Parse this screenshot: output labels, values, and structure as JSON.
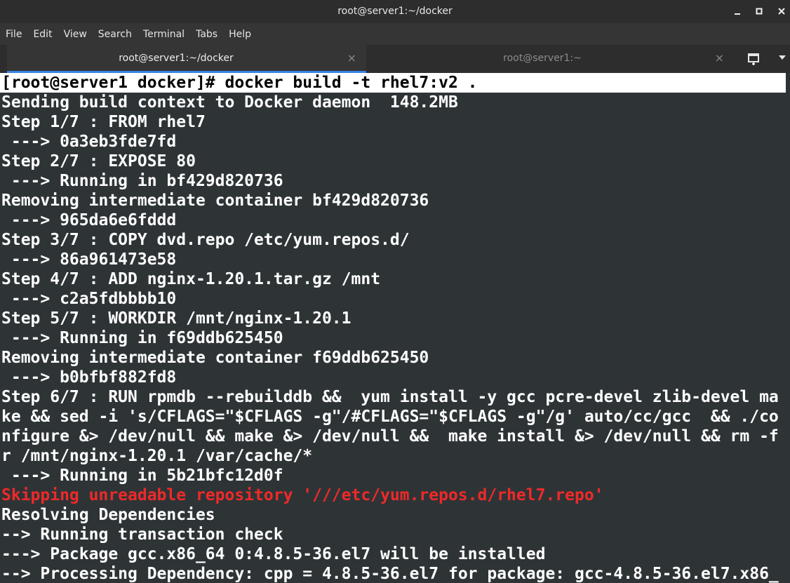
{
  "window": {
    "title": "root@server1:~/docker",
    "minimize_icon": "minimize-icon",
    "maximize_icon": "maximize-icon",
    "close_icon": "close-icon"
  },
  "menubar": {
    "items": [
      "File",
      "Edit",
      "View",
      "Search",
      "Terminal",
      "Tabs",
      "Help"
    ]
  },
  "tabs": [
    {
      "label": "root@server1:~/docker",
      "active": true,
      "close": "×"
    },
    {
      "label": "root@server1:~",
      "active": false,
      "close": "×"
    }
  ],
  "tab_actions": {
    "new_tab_icon": "new-tab-icon",
    "tab_menu_icon": "chevron-down-icon"
  },
  "colors": {
    "terminal_bg": "#2e3436",
    "text": "#ffffff",
    "error": "#ef2929",
    "accent": "#3584e4"
  },
  "terminal": {
    "lines": [
      "[root@server1 docker]# docker build -t rhel7:v2 .",
      "Sending build context to Docker daemon  148.2MB",
      "Step 1/7 : FROM rhel7",
      " ---> 0a3eb3fde7fd",
      "Step 2/7 : EXPOSE 80",
      " ---> Running in bf429d820736",
      "Removing intermediate container bf429d820736",
      " ---> 965da6e6fddd",
      "Step 3/7 : COPY dvd.repo /etc/yum.repos.d/",
      " ---> 86a961473e58",
      "Step 4/7 : ADD nginx-1.20.1.tar.gz /mnt",
      " ---> c2a5fdbbbb10",
      "Step 5/7 : WORKDIR /mnt/nginx-1.20.1",
      " ---> Running in f69ddb625450",
      "Removing intermediate container f69ddb625450",
      " ---> b0bfbf882fd8",
      "Step 6/7 : RUN rpmdb --rebuilddb &&  yum install -y gcc pcre-devel zlib-devel ma",
      "ke && sed -i 's/CFLAGS=\"$CFLAGS -g\"/#CFLAGS=\"$CFLAGS -g\"/g' auto/cc/gcc  && ./co",
      "nfigure &> /dev/null && make &> /dev/null &&  make install &> /dev/null && rm -f",
      "r /mnt/nginx-1.20.1 /var/cache/*",
      " ---> Running in 5b21bfc12d0f",
      "Skipping unreadable repository '///etc/yum.repos.d/rhel7.repo'",
      "Resolving Dependencies",
      "--> Running transaction check",
      "---> Package gcc.x86_64 0:4.8.5-36.el7 will be installed",
      "--> Processing Dependency: cpp = 4.8.5-36.el7 for package: gcc-4.8.5-36.el7.x86_"
    ]
  }
}
